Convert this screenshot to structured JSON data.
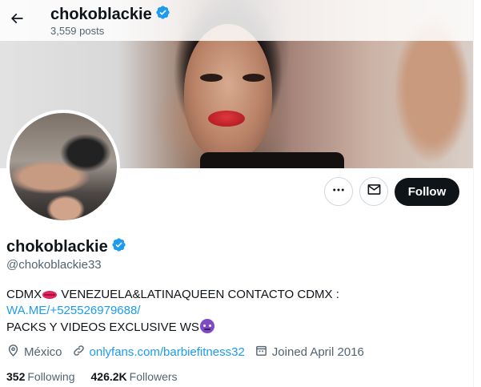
{
  "header": {
    "name": "chokoblackie",
    "posts": "3,559 posts"
  },
  "icons": {
    "back": "arrow-left-icon",
    "verified": "verified-badge-icon",
    "more": "more-horizontal-icon",
    "message": "envelope-icon",
    "location": "location-pin-icon",
    "link": "link-icon",
    "calendar": "calendar-icon"
  },
  "actions": {
    "follow_label": "Follow"
  },
  "profile": {
    "display_name": "chokoblackie",
    "handle": "@chokoblackie33",
    "bio_line1_a": "CDMX",
    "bio_line1_b": " VENEZUELA&LATINAQUEEN CONTACTO CDMX :",
    "bio_link": "WA.ME/+525526979688/",
    "bio_line3": "PACKS Y VIDEOS EXCLUSIVE WS",
    "location": "México",
    "website": "onlyfans.com/barbiefitness32",
    "joined": "Joined April 2016"
  },
  "stats": {
    "following_count": "352",
    "following_label": "Following",
    "followers_count": "426.2K",
    "followers_label": "Followers"
  },
  "colors": {
    "accent": "#1d9bf0",
    "text": "#0f1419",
    "secondary": "#536471",
    "follow_bg": "#0f1419"
  }
}
